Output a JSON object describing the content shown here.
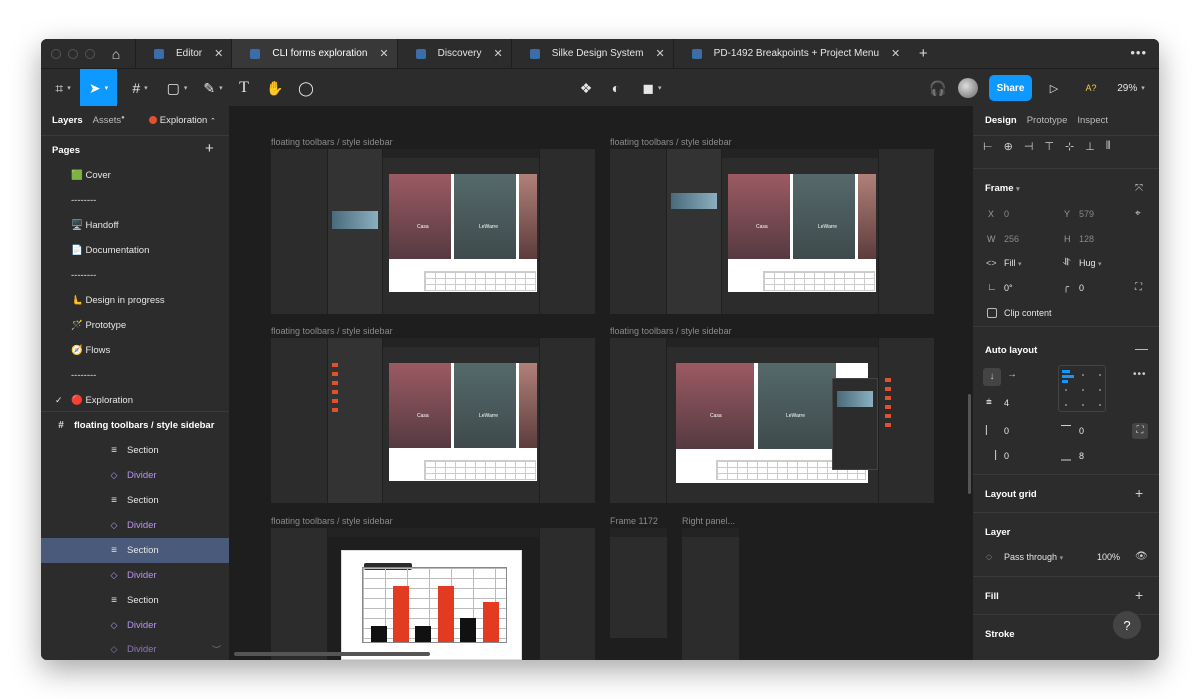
{
  "tabs": [
    {
      "label": "Editor",
      "active": false
    },
    {
      "label": "CLI forms exploration",
      "active": true
    },
    {
      "label": "Discovery",
      "active": false
    },
    {
      "label": "Silke Design System",
      "active": false
    },
    {
      "label": "PD-1492 Breakpoints + Project Menu",
      "active": false
    }
  ],
  "toolbar": {
    "share_label": "Share",
    "zoom": "29%",
    "a_label": "A?"
  },
  "left_panel": {
    "tab_layers": "Layers",
    "tab_assets": "Assets",
    "page_selector": "Exploration",
    "pages_heading": "Pages",
    "pages": [
      {
        "label": "🟩 Cover"
      },
      {
        "label": "--------"
      },
      {
        "label": "🖥️ Handoff"
      },
      {
        "label": "📄 Documentation"
      },
      {
        "label": "--------"
      },
      {
        "label": "🫷 Design in progress"
      },
      {
        "label": "🪄 Prototype"
      },
      {
        "label": "🧭 Flows"
      },
      {
        "label": "--------"
      },
      {
        "label": "🔴 Exploration",
        "current": true
      }
    ],
    "frame_name": "floating toolbars / style sidebar",
    "layers": [
      {
        "label": "Section",
        "type": "section"
      },
      {
        "label": "Divider",
        "type": "divider"
      },
      {
        "label": "Section",
        "type": "section"
      },
      {
        "label": "Divider",
        "type": "divider"
      },
      {
        "label": "Section",
        "type": "section",
        "selected": true
      },
      {
        "label": "Divider",
        "type": "divider"
      },
      {
        "label": "Section",
        "type": "section"
      },
      {
        "label": "Divider",
        "type": "divider"
      },
      {
        "label": "Divider",
        "type": "divider"
      }
    ]
  },
  "canvas": {
    "frame_labels": [
      "floating toolbars / style sidebar",
      "floating toolbars / style sidebar",
      "floating toolbars / style sidebar",
      "floating toolbars / style sidebar",
      "floating toolbars / style sidebar",
      "Frame 1172",
      "Right panel..."
    ],
    "photo_texts": [
      "Casa",
      "LeWarre"
    ]
  },
  "right_panel": {
    "tab_design": "Design",
    "tab_prototype": "Prototype",
    "tab_inspect": "Inspect",
    "frame": {
      "heading": "Frame",
      "x_label": "X",
      "x": "0",
      "y_label": "Y",
      "y": "579",
      "w_label": "W",
      "w": "256",
      "h_label": "H",
      "h": "128",
      "width_mode": "Fill",
      "height_mode": "Hug",
      "rotation": "0°",
      "radius": "0",
      "clip_content": "Clip content"
    },
    "auto_layout": {
      "heading": "Auto layout",
      "spacing": "4",
      "pad_left": "0",
      "pad_top": "0",
      "pad_right": "0",
      "pad_bottom": "8"
    },
    "layout_grid": "Layout grid",
    "layer": {
      "heading": "Layer",
      "blend": "Pass through",
      "opacity": "100%"
    },
    "fill": "Fill",
    "stroke": "Stroke",
    "help": "?"
  },
  "colors": {
    "accent": "#0d99ff",
    "panel": "#2c2c2c",
    "canvas": "#1e1e1e",
    "divider_purple": "#b894f2",
    "selected_row": "#4a5a7a",
    "chart_red": "#e23b22"
  },
  "icons": [
    "home-icon",
    "figma-menu-icon",
    "move-tool-icon",
    "frame-tool-icon",
    "shape-tool-icon",
    "pen-tool-icon",
    "text-tool-icon",
    "hand-tool-icon",
    "comment-icon",
    "component-icon",
    "contrast-icon",
    "boolean-icon",
    "headphones-icon",
    "play-icon"
  ]
}
